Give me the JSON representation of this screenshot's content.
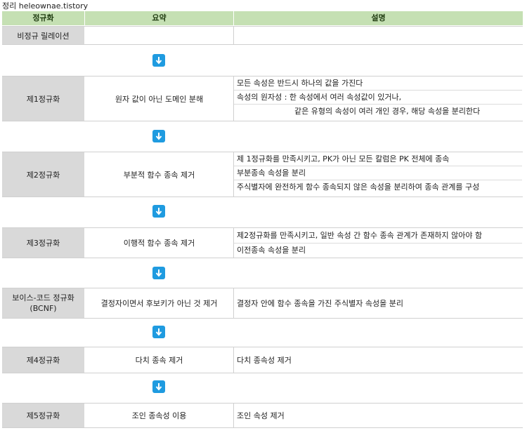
{
  "caption": "정리 heleownae.tistory",
  "header": {
    "col1": "정규화",
    "col2": "요약",
    "col3": "설명"
  },
  "rows": [
    {
      "name": "비정규 릴레이션",
      "summary": "",
      "desc": []
    },
    {
      "name": "제1정규화",
      "summary": "원자 값이 아닌 도메인 분해",
      "desc": [
        "모든 속성은 반드시 하나의 값을 가진다",
        "속성의 원자성 : 한 속성에서 여러 속성값이 있거나,",
        "같은 유형의 속성이 여러 개인 경우, 해당 속성을 분리한다"
      ]
    },
    {
      "name": "제2정규화",
      "summary": "부분적 함수 종속 제거",
      "desc": [
        "제 1정규화를 만족시키고, PK가 아닌 모든 칼럼은 PK 전체에 종속",
        "부분종속 속성을 분리",
        "주식별자에 완전하게 함수 종속되지 않은 속성을 분리하여 종속 관계를 구성"
      ]
    },
    {
      "name": "제3정규화",
      "summary": "이행적 함수 종속 제거",
      "desc": [
        "제2정규화를 만족시키고, 일반 속성 간 함수 종속 관계가 존재하지 않아야 함",
        "이전종속 속성을 분리"
      ]
    },
    {
      "name": "보이스-코드 정규화\n(BCNF)",
      "summary": "결정자이면서 후보키가 아닌 것 제거",
      "desc": [
        "결정자 안에 함수 종속을 가진 주식별자 속성을 분리"
      ]
    },
    {
      "name": "제4정규화",
      "summary": "다치 종속 제거",
      "desc": [
        "다치 종속성 제거"
      ]
    },
    {
      "name": "제5정규화",
      "summary": "조인 종속성 이용",
      "desc": [
        "조인 속성 제거"
      ]
    }
  ],
  "colors": {
    "header_bg": "#c5e0b3",
    "name_bg": "#d9d9d9",
    "arrow": "#1f9be0"
  },
  "icons": {
    "arrow": "arrow-down-icon"
  }
}
